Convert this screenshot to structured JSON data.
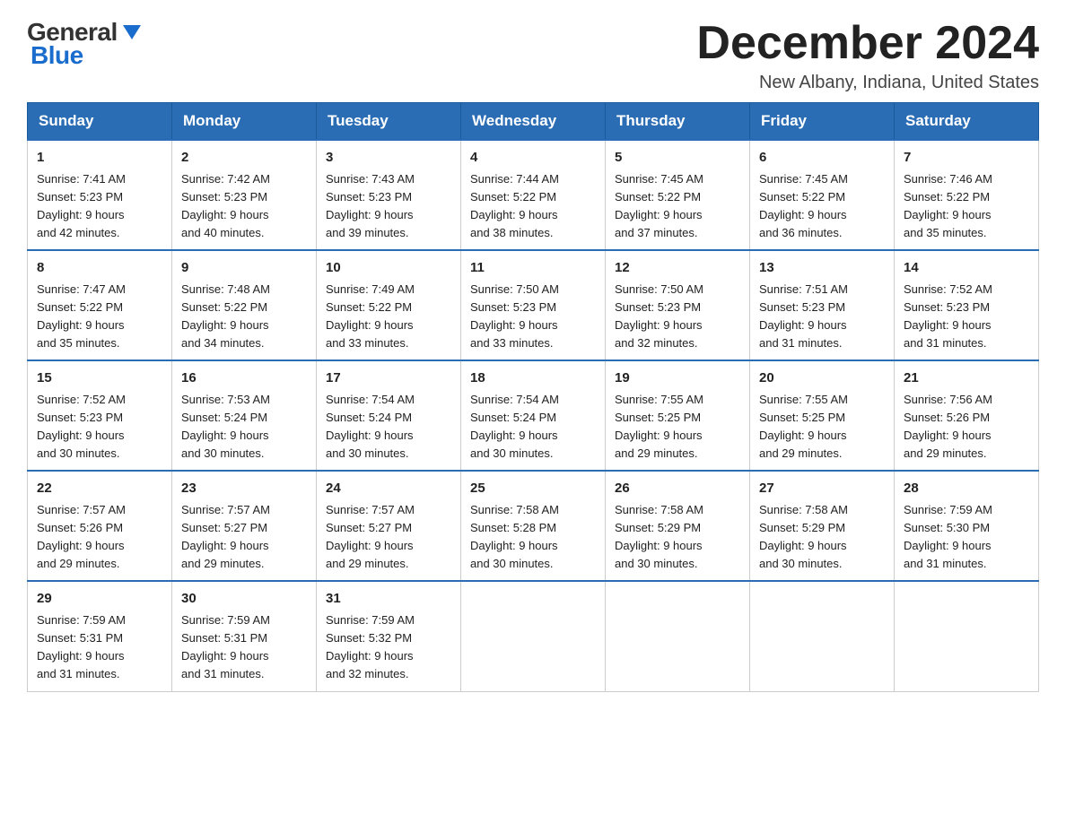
{
  "header": {
    "logo_general": "General",
    "logo_blue": "Blue",
    "month_title": "December 2024",
    "location": "New Albany, Indiana, United States"
  },
  "days_of_week": [
    "Sunday",
    "Monday",
    "Tuesday",
    "Wednesday",
    "Thursday",
    "Friday",
    "Saturday"
  ],
  "weeks": [
    [
      {
        "day": "1",
        "sunrise": "7:41 AM",
        "sunset": "5:23 PM",
        "daylight": "9 hours and 42 minutes."
      },
      {
        "day": "2",
        "sunrise": "7:42 AM",
        "sunset": "5:23 PM",
        "daylight": "9 hours and 40 minutes."
      },
      {
        "day": "3",
        "sunrise": "7:43 AM",
        "sunset": "5:23 PM",
        "daylight": "9 hours and 39 minutes."
      },
      {
        "day": "4",
        "sunrise": "7:44 AM",
        "sunset": "5:22 PM",
        "daylight": "9 hours and 38 minutes."
      },
      {
        "day": "5",
        "sunrise": "7:45 AM",
        "sunset": "5:22 PM",
        "daylight": "9 hours and 37 minutes."
      },
      {
        "day": "6",
        "sunrise": "7:45 AM",
        "sunset": "5:22 PM",
        "daylight": "9 hours and 36 minutes."
      },
      {
        "day": "7",
        "sunrise": "7:46 AM",
        "sunset": "5:22 PM",
        "daylight": "9 hours and 35 minutes."
      }
    ],
    [
      {
        "day": "8",
        "sunrise": "7:47 AM",
        "sunset": "5:22 PM",
        "daylight": "9 hours and 35 minutes."
      },
      {
        "day": "9",
        "sunrise": "7:48 AM",
        "sunset": "5:22 PM",
        "daylight": "9 hours and 34 minutes."
      },
      {
        "day": "10",
        "sunrise": "7:49 AM",
        "sunset": "5:22 PM",
        "daylight": "9 hours and 33 minutes."
      },
      {
        "day": "11",
        "sunrise": "7:50 AM",
        "sunset": "5:23 PM",
        "daylight": "9 hours and 33 minutes."
      },
      {
        "day": "12",
        "sunrise": "7:50 AM",
        "sunset": "5:23 PM",
        "daylight": "9 hours and 32 minutes."
      },
      {
        "day": "13",
        "sunrise": "7:51 AM",
        "sunset": "5:23 PM",
        "daylight": "9 hours and 31 minutes."
      },
      {
        "day": "14",
        "sunrise": "7:52 AM",
        "sunset": "5:23 PM",
        "daylight": "9 hours and 31 minutes."
      }
    ],
    [
      {
        "day": "15",
        "sunrise": "7:52 AM",
        "sunset": "5:23 PM",
        "daylight": "9 hours and 30 minutes."
      },
      {
        "day": "16",
        "sunrise": "7:53 AM",
        "sunset": "5:24 PM",
        "daylight": "9 hours and 30 minutes."
      },
      {
        "day": "17",
        "sunrise": "7:54 AM",
        "sunset": "5:24 PM",
        "daylight": "9 hours and 30 minutes."
      },
      {
        "day": "18",
        "sunrise": "7:54 AM",
        "sunset": "5:24 PM",
        "daylight": "9 hours and 30 minutes."
      },
      {
        "day": "19",
        "sunrise": "7:55 AM",
        "sunset": "5:25 PM",
        "daylight": "9 hours and 29 minutes."
      },
      {
        "day": "20",
        "sunrise": "7:55 AM",
        "sunset": "5:25 PM",
        "daylight": "9 hours and 29 minutes."
      },
      {
        "day": "21",
        "sunrise": "7:56 AM",
        "sunset": "5:26 PM",
        "daylight": "9 hours and 29 minutes."
      }
    ],
    [
      {
        "day": "22",
        "sunrise": "7:57 AM",
        "sunset": "5:26 PM",
        "daylight": "9 hours and 29 minutes."
      },
      {
        "day": "23",
        "sunrise": "7:57 AM",
        "sunset": "5:27 PM",
        "daylight": "9 hours and 29 minutes."
      },
      {
        "day": "24",
        "sunrise": "7:57 AM",
        "sunset": "5:27 PM",
        "daylight": "9 hours and 29 minutes."
      },
      {
        "day": "25",
        "sunrise": "7:58 AM",
        "sunset": "5:28 PM",
        "daylight": "9 hours and 30 minutes."
      },
      {
        "day": "26",
        "sunrise": "7:58 AM",
        "sunset": "5:29 PM",
        "daylight": "9 hours and 30 minutes."
      },
      {
        "day": "27",
        "sunrise": "7:58 AM",
        "sunset": "5:29 PM",
        "daylight": "9 hours and 30 minutes."
      },
      {
        "day": "28",
        "sunrise": "7:59 AM",
        "sunset": "5:30 PM",
        "daylight": "9 hours and 31 minutes."
      }
    ],
    [
      {
        "day": "29",
        "sunrise": "7:59 AM",
        "sunset": "5:31 PM",
        "daylight": "9 hours and 31 minutes."
      },
      {
        "day": "30",
        "sunrise": "7:59 AM",
        "sunset": "5:31 PM",
        "daylight": "9 hours and 31 minutes."
      },
      {
        "day": "31",
        "sunrise": "7:59 AM",
        "sunset": "5:32 PM",
        "daylight": "9 hours and 32 minutes."
      },
      null,
      null,
      null,
      null
    ]
  ],
  "labels": {
    "sunrise": "Sunrise: ",
    "sunset": "Sunset: ",
    "daylight": "Daylight: "
  }
}
